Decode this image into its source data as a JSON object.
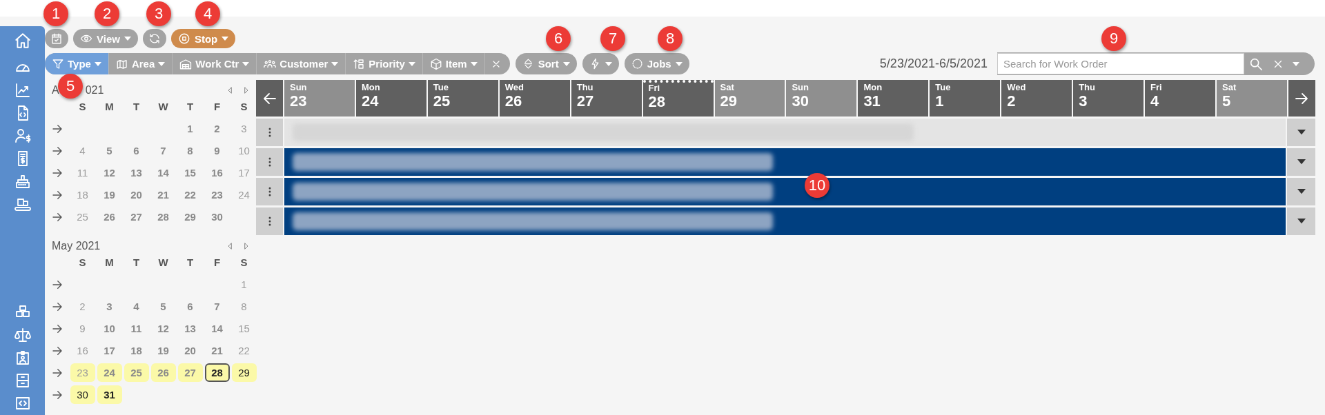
{
  "toolbar": [
    {
      "kind": "icon",
      "color": "#a3a3a3"
    },
    {
      "kind": "dropdown",
      "label": "View",
      "color": "#a3a3a3"
    },
    {
      "kind": "icon",
      "color": "#a3a3a3"
    },
    {
      "kind": "dropdown",
      "label": "Stop",
      "color": "#cf8b4c"
    }
  ],
  "filters": [
    {
      "label": "Type",
      "selected": true
    },
    {
      "label": "Area",
      "selected": false
    },
    {
      "label": "Work Ctr",
      "selected": false
    },
    {
      "label": "Customer",
      "selected": false
    },
    {
      "label": "Priority",
      "selected": false
    },
    {
      "label": "Item",
      "selected": false
    }
  ],
  "actions": [
    {
      "kind": "dropdown",
      "label": "Sort"
    },
    {
      "kind": "icon"
    },
    {
      "kind": "dropdown",
      "label": "Jobs"
    }
  ],
  "date_range": "5/23/2021-6/5/2021",
  "search": {
    "placeholder": "Search for Work Order"
  },
  "months": [
    {
      "title_parts": [
        "A",
        "021"
      ],
      "weekday_heads": [
        "S",
        "M",
        "T",
        "W",
        "T",
        "F",
        "S"
      ],
      "days": [
        {
          "d": "1",
          "selected": false,
          "today": false,
          "past": true
        },
        {
          "d": "2",
          "selected": false,
          "today": false,
          "past": true
        },
        {
          "d": "3",
          "selected": false,
          "today": false,
          "past": true
        },
        {
          "d": "4",
          "selected": false,
          "today": false,
          "past": true
        },
        {
          "d": "5",
          "selected": false,
          "today": false,
          "past": true
        },
        {
          "d": "6",
          "selected": false,
          "today": false,
          "past": true
        },
        {
          "d": "7",
          "selected": false,
          "today": false,
          "past": true
        },
        {
          "d": "8",
          "selected": false,
          "today": false,
          "past": true
        },
        {
          "d": "9",
          "selected": false,
          "today": false,
          "past": true
        },
        {
          "d": "10",
          "selected": false,
          "today": false,
          "past": true
        },
        {
          "d": "11",
          "selected": false,
          "today": false,
          "past": true
        },
        {
          "d": "12",
          "selected": false,
          "today": false,
          "past": true
        },
        {
          "d": "13",
          "selected": false,
          "today": false,
          "past": true
        },
        {
          "d": "14",
          "selected": false,
          "today": false,
          "past": true
        },
        {
          "d": "15",
          "selected": false,
          "today": false,
          "past": true
        },
        {
          "d": "16",
          "selected": false,
          "today": false,
          "past": true
        },
        {
          "d": "17",
          "selected": false,
          "today": false,
          "past": true
        },
        {
          "d": "18",
          "selected": false,
          "today": false,
          "past": true
        },
        {
          "d": "19",
          "selected": false,
          "today": false,
          "past": true
        },
        {
          "d": "20",
          "selected": false,
          "today": false,
          "past": true
        },
        {
          "d": "21",
          "selected": false,
          "today": false,
          "past": true
        },
        {
          "d": "22",
          "selected": false,
          "today": false,
          "past": true
        },
        {
          "d": "23",
          "selected": false,
          "today": false,
          "past": true
        },
        {
          "d": "24",
          "selected": false,
          "today": false,
          "past": true
        },
        {
          "d": "25",
          "selected": false,
          "today": false,
          "past": true
        },
        {
          "d": "26",
          "selected": false,
          "today": false,
          "past": true
        },
        {
          "d": "27",
          "selected": false,
          "today": false,
          "past": true
        },
        {
          "d": "28",
          "selected": false,
          "today": false,
          "past": true
        },
        {
          "d": "29",
          "selected": false,
          "today": false,
          "past": true
        },
        {
          "d": "30",
          "selected": false,
          "today": false,
          "past": true
        }
      ]
    },
    {
      "title_parts": [
        "May 2021"
      ],
      "weekday_heads": [
        "S",
        "M",
        "T",
        "W",
        "T",
        "F",
        "S"
      ],
      "days": [
        {
          "d": "1",
          "selected": false,
          "today": false,
          "past": true
        },
        {
          "d": "2",
          "selected": false,
          "today": false,
          "past": true
        },
        {
          "d": "3",
          "selected": false,
          "today": false,
          "past": true
        },
        {
          "d": "4",
          "selected": false,
          "today": false,
          "past": true
        },
        {
          "d": "5",
          "selected": false,
          "today": false,
          "past": true
        },
        {
          "d": "6",
          "selected": false,
          "today": false,
          "past": true
        },
        {
          "d": "7",
          "selected": false,
          "today": false,
          "past": true
        },
        {
          "d": "8",
          "selected": false,
          "today": false,
          "past": true
        },
        {
          "d": "9",
          "selected": false,
          "today": false,
          "past": true
        },
        {
          "d": "10",
          "selected": false,
          "today": false,
          "past": true
        },
        {
          "d": "11",
          "selected": false,
          "today": false,
          "past": true
        },
        {
          "d": "12",
          "selected": false,
          "today": false,
          "past": true
        },
        {
          "d": "13",
          "selected": false,
          "today": false,
          "past": true
        },
        {
          "d": "14",
          "selected": false,
          "today": false,
          "past": true
        },
        {
          "d": "15",
          "selected": false,
          "today": false,
          "past": true
        },
        {
          "d": "16",
          "selected": false,
          "today": false,
          "past": true
        },
        {
          "d": "17",
          "selected": false,
          "today": false,
          "past": true
        },
        {
          "d": "18",
          "selected": false,
          "today": false,
          "past": true
        },
        {
          "d": "19",
          "selected": false,
          "today": false,
          "past": true
        },
        {
          "d": "20",
          "selected": false,
          "today": false,
          "past": true
        },
        {
          "d": "21",
          "selected": false,
          "today": false,
          "past": true
        },
        {
          "d": "22",
          "selected": false,
          "today": false,
          "past": true
        },
        {
          "d": "23",
          "selected": true,
          "today": false,
          "past": true
        },
        {
          "d": "24",
          "selected": true,
          "today": false,
          "past": true
        },
        {
          "d": "25",
          "selected": true,
          "today": false,
          "past": true
        },
        {
          "d": "26",
          "selected": true,
          "today": false,
          "past": true
        },
        {
          "d": "27",
          "selected": true,
          "today": false,
          "past": true
        },
        {
          "d": "28",
          "selected": true,
          "today": true,
          "past": false
        },
        {
          "d": "29",
          "selected": true,
          "today": false,
          "past": false
        },
        {
          "d": "30",
          "selected": true,
          "today": false,
          "past": false
        },
        {
          "d": "31",
          "selected": true,
          "today": false,
          "past": false
        }
      ]
    }
  ],
  "gantt": {
    "days": [
      {
        "dow": "Sun",
        "d": "23",
        "today": false
      },
      {
        "dow": "Mon",
        "d": "24",
        "today": false
      },
      {
        "dow": "Tue",
        "d": "25",
        "today": false
      },
      {
        "dow": "Wed",
        "d": "26",
        "today": false
      },
      {
        "dow": "Thu",
        "d": "27",
        "today": false
      },
      {
        "dow": "Fri",
        "d": "28",
        "today": true
      },
      {
        "dow": "Sat",
        "d": "29",
        "today": false
      },
      {
        "dow": "Sun",
        "d": "30",
        "today": false
      },
      {
        "dow": "Mon",
        "d": "31",
        "today": false
      },
      {
        "dow": "Tue",
        "d": "1",
        "today": false
      },
      {
        "dow": "Wed",
        "d": "2",
        "today": false
      },
      {
        "dow": "Thu",
        "d": "3",
        "today": false
      },
      {
        "dow": "Fri",
        "d": "4",
        "today": false
      },
      {
        "dow": "Sat",
        "d": "5",
        "today": false
      }
    ],
    "rows": [
      {
        "color": "#e4e4e4"
      },
      {
        "color": "#003f80"
      },
      {
        "color": "#003f80"
      },
      {
        "color": "#003f80"
      }
    ]
  },
  "callouts": [
    {
      "n": "1"
    },
    {
      "n": "2"
    },
    {
      "n": "3"
    },
    {
      "n": "4"
    },
    {
      "n": "5"
    },
    {
      "n": "6"
    },
    {
      "n": "7"
    },
    {
      "n": "8"
    },
    {
      "n": "9"
    },
    {
      "n": "10"
    }
  ]
}
